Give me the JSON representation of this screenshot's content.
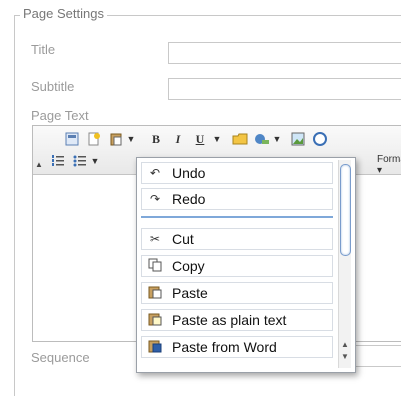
{
  "fieldset": {
    "legend": "Page Settings"
  },
  "labels": {
    "title": "Title",
    "subtitle": "Subtitle",
    "page_text": "Page Text",
    "sequence": "Sequence"
  },
  "inputs": {
    "title_value": "",
    "subtitle_value": "",
    "sequence_value": ""
  },
  "toolbar": {
    "bold": "B",
    "italic": "I",
    "underline": "U",
    "format_label": "Format"
  },
  "menu": {
    "items": [
      {
        "icon": "undo-icon",
        "label": "Undo"
      },
      {
        "icon": "redo-icon",
        "label": "Redo"
      },
      {
        "icon": "cut-icon",
        "label": "Cut"
      },
      {
        "icon": "copy-icon",
        "label": "Copy"
      },
      {
        "icon": "paste-icon",
        "label": "Paste"
      },
      {
        "icon": "paste-text-icon",
        "label": "Paste as plain text"
      },
      {
        "icon": "paste-word-icon",
        "label": "Paste from Word"
      }
    ]
  },
  "colors": {
    "accent": "#7fa8d9",
    "border": "#c9c9c9"
  }
}
